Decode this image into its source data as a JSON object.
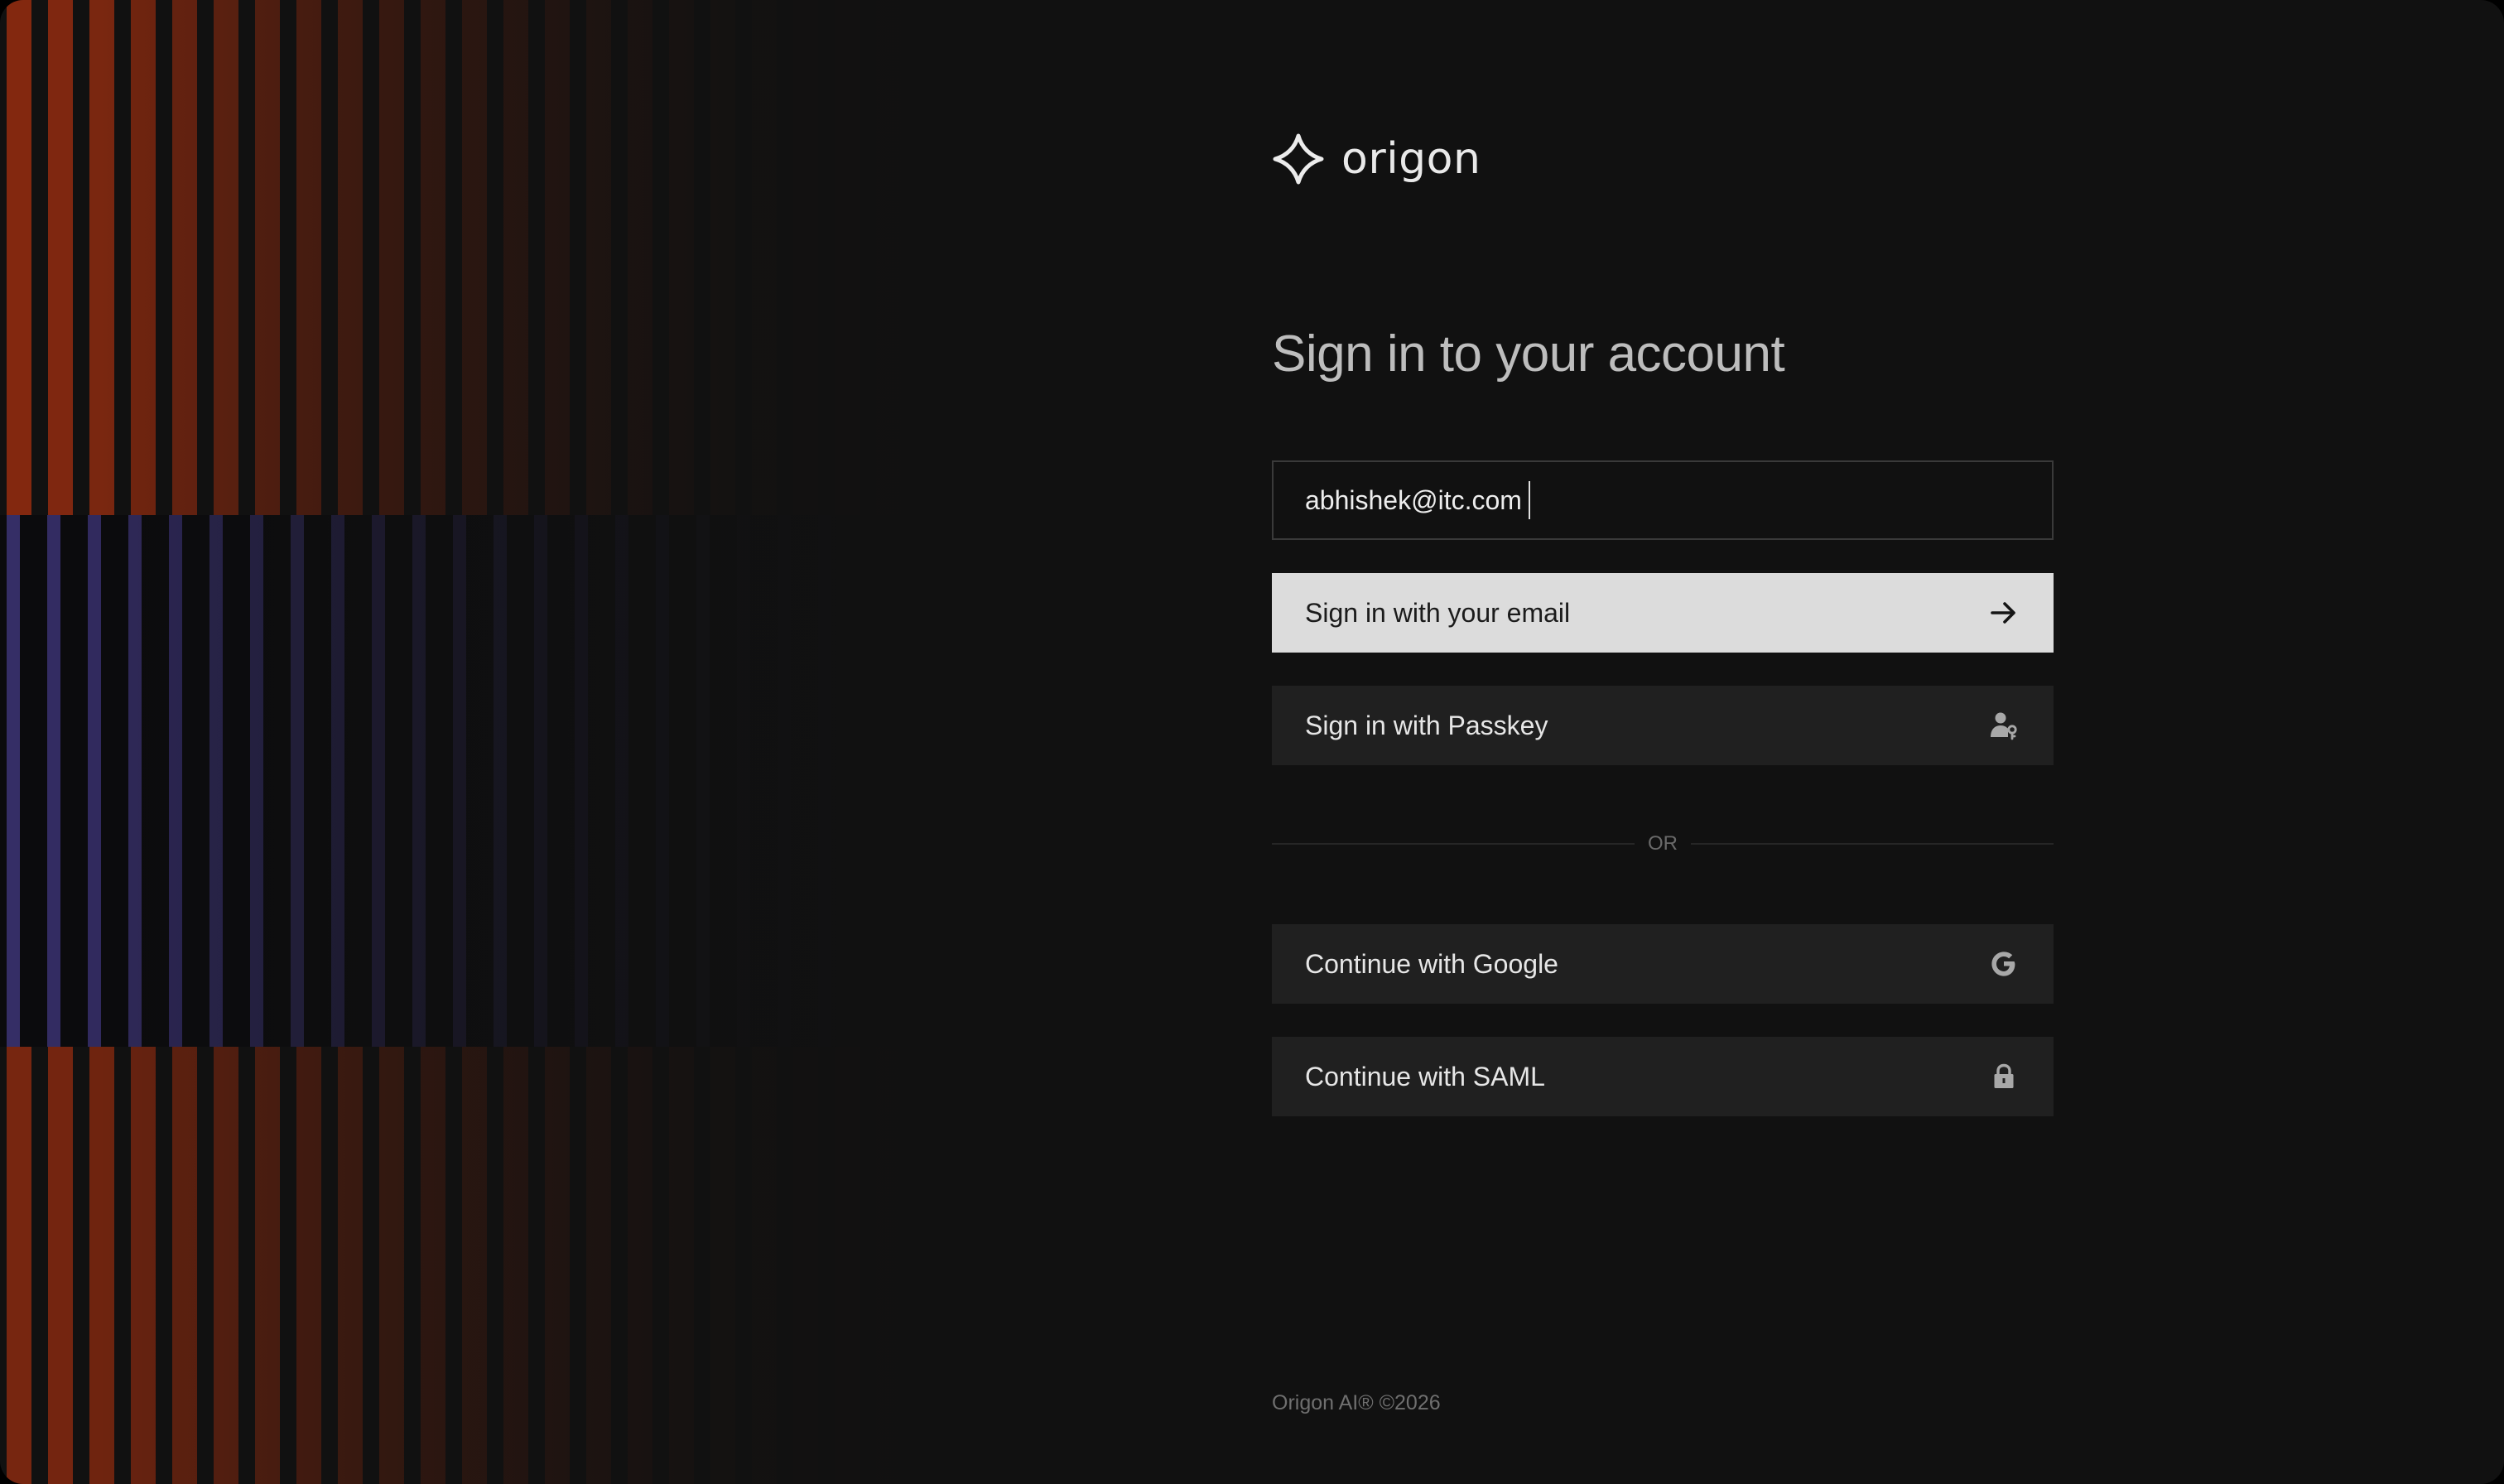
{
  "brand": {
    "name": "origon",
    "logo_icon": "origon-star-icon"
  },
  "signin": {
    "title": "Sign in to your account",
    "email_value": "abhishek@itc.com",
    "email_button_label": "Sign in with your email",
    "email_button_icon": "arrow-right-icon",
    "passkey_button_label": "Sign in with Passkey",
    "passkey_button_icon": "user-key-icon",
    "divider_text": "OR",
    "google_button_label": "Continue with Google",
    "google_button_icon": "google-icon",
    "saml_button_label": "Continue with SAML",
    "saml_button_icon": "lock-icon"
  },
  "footer": {
    "copyright": "Origon AI® ©2026"
  },
  "colors": {
    "background": "#111111",
    "primary_button": "#dcdcdc",
    "dark_button": "#202020",
    "art_warm": "#8a2a10",
    "art_cool": "#3a3270"
  }
}
